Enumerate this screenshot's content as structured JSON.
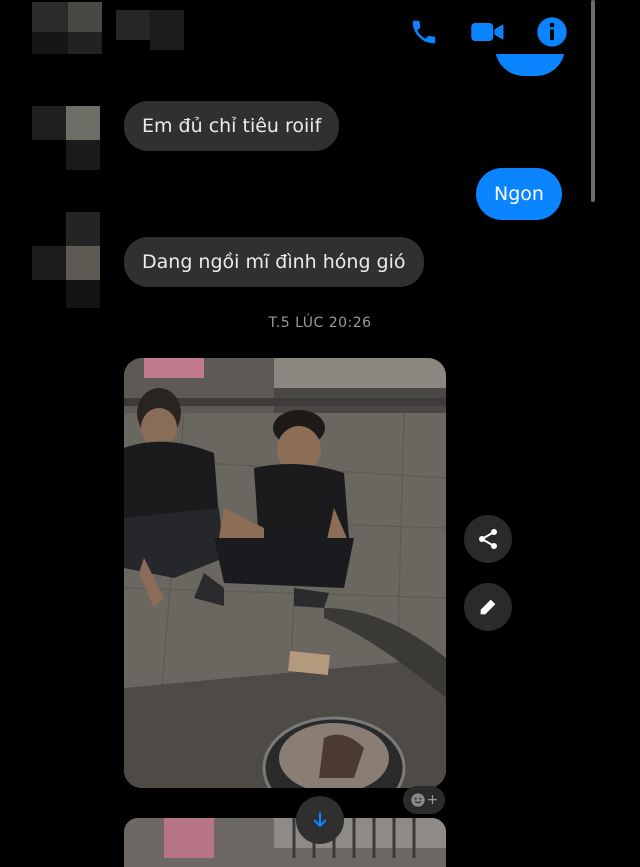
{
  "header": {
    "call_icon": "phone-icon",
    "video_icon": "video-camera-icon",
    "info_icon": "info-icon",
    "accent_color": "#0a84ff"
  },
  "messages": [
    {
      "direction": "incoming",
      "text": "Em đủ chỉ tiêu roiif"
    },
    {
      "direction": "outgoing",
      "text": "Ngon"
    },
    {
      "direction": "incoming",
      "text": "Dang ngồi mĩ đình hóng gió"
    }
  ],
  "timestamp": "T.5 LÚC 20:26",
  "photo_actions": {
    "share_icon": "share-icon",
    "edit_icon": "pencil-icon",
    "reaction_icon": "smiley-add-icon",
    "reaction_plus": "+"
  },
  "scroll_down_icon": "arrow-down-icon"
}
